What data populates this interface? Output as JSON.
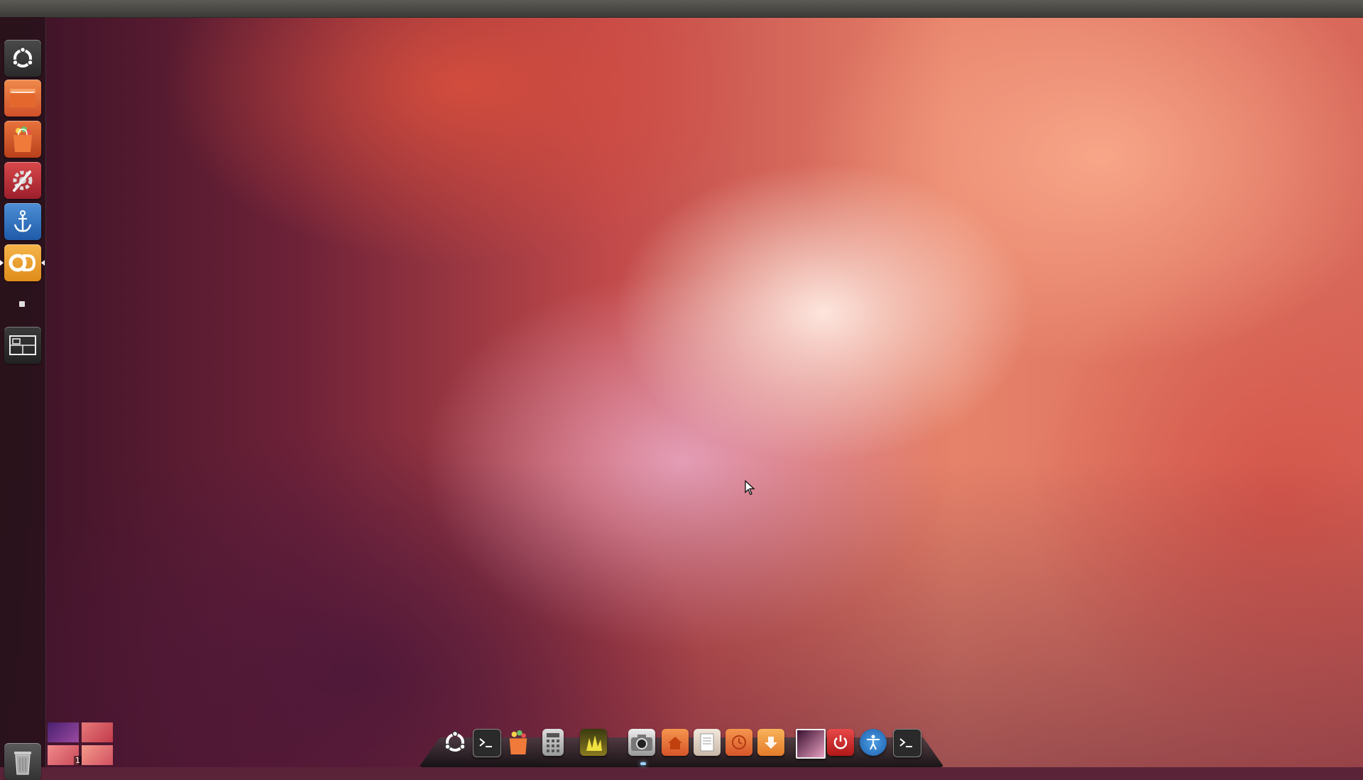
{
  "workspace_switcher": {
    "active_number": "1"
  },
  "launcher": {
    "items": [
      {
        "name": "dash-home",
        "icon": "ubuntu-logo-icon"
      },
      {
        "name": "files",
        "icon": "folder-icon"
      },
      {
        "name": "software-center",
        "icon": "shopping-bag-icon"
      },
      {
        "name": "system-settings",
        "icon": "tools-icon"
      },
      {
        "name": "anchor-app",
        "icon": "anchor-icon"
      },
      {
        "name": "cd-app",
        "icon": "cd-icon"
      },
      {
        "name": "workspace-switcher",
        "icon": "workspace-icon"
      },
      {
        "name": "trash",
        "icon": "trash-icon"
      }
    ]
  },
  "dock": {
    "items": [
      {
        "name": "ubuntu",
        "icon": "ubuntu-logo-icon"
      },
      {
        "name": "terminal",
        "icon": "terminal-icon"
      },
      {
        "name": "software-center",
        "icon": "shopping-bag-icon"
      },
      {
        "name": "calculator",
        "icon": "calculator-icon"
      },
      {
        "name": "image-viewer",
        "icon": "photo-icon"
      },
      {
        "name": "camera",
        "icon": "camera-icon"
      },
      {
        "name": "home-folder",
        "icon": "home-folder-icon"
      },
      {
        "name": "documents",
        "icon": "documents-icon"
      },
      {
        "name": "recent",
        "icon": "clock-folder-icon"
      },
      {
        "name": "downloads",
        "icon": "downloads-folder-icon"
      },
      {
        "name": "desktop-screenshot",
        "icon": "screen-icon"
      },
      {
        "name": "shutdown",
        "icon": "power-icon"
      },
      {
        "name": "accessibility",
        "icon": "accessibility-icon"
      },
      {
        "name": "terminal-2",
        "icon": "terminal-icon"
      }
    ]
  },
  "colors": {
    "launcher_bg": "#28121a",
    "panel_bg": "#3c3b37",
    "accent_orange": "#dd4814"
  }
}
